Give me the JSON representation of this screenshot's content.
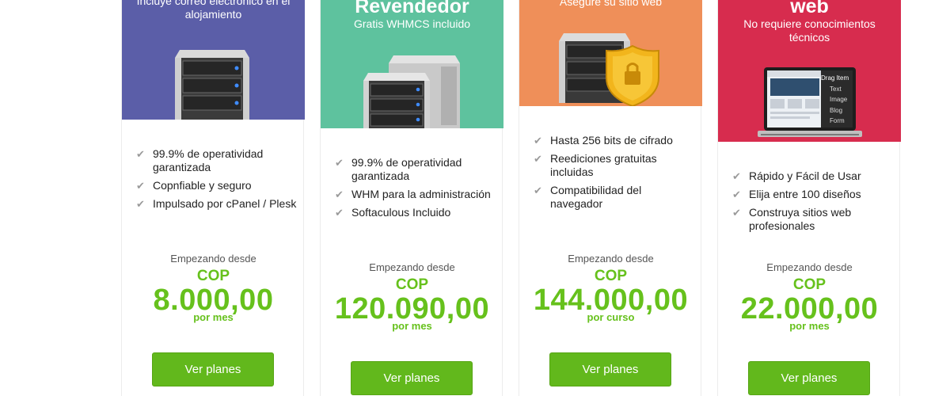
{
  "plans": [
    {
      "title": "",
      "subtitle": "Incluye correo electrónico en el alojamiento",
      "header_color": "#5b5ea8",
      "features": [
        "99.9% de operatividad garantizada",
        "Copnfiable y seguro",
        "Impulsado por cPanel / Plesk"
      ],
      "price_from": "Empezando desde",
      "currency": "COP",
      "amount": "8.000,00",
      "period": "por mes",
      "button": "Ver planes",
      "icon": "server-icon"
    },
    {
      "title": "Revendedor",
      "subtitle": "Gratis WHMCS incluido",
      "header_color": "#5ec29e",
      "features": [
        "99.9% de operatividad garantizada",
        "WHM para la administración",
        "Softaculous Incluido"
      ],
      "price_from": "Empezando desde",
      "currency": "COP",
      "amount": "120.090,00",
      "period": "por mes",
      "button": "Ver planes",
      "icon": "double-server-icon"
    },
    {
      "title": "",
      "subtitle": "Asegure su sitio web",
      "header_color": "#ef8f59",
      "features": [
        "Hasta 256 bits de cifrado",
        "Reediciones gratuitas incluidas",
        "Compatibilidad del navegador"
      ],
      "price_from": "Empezando desde",
      "currency": "COP",
      "amount": "144.000,00",
      "period": "por curso",
      "button": "Ver planes",
      "icon": "ssl-shield-icon"
    },
    {
      "title": "web",
      "subtitle": "No requiere conocimientos técnicos",
      "header_color": "#d72c4e",
      "features": [
        "Rápido y Fácil de Usar",
        "Elija entre 100 diseños",
        "Construya sitios web profesionales"
      ],
      "price_from": "Empezando desde",
      "currency": "COP",
      "amount": "22.000,00",
      "period": "por mes",
      "button": "Ver planes",
      "icon": "laptop-builder-icon",
      "builder_panel": [
        "Drag Item",
        "Text",
        "Image",
        "Blog",
        "Form"
      ]
    }
  ]
}
